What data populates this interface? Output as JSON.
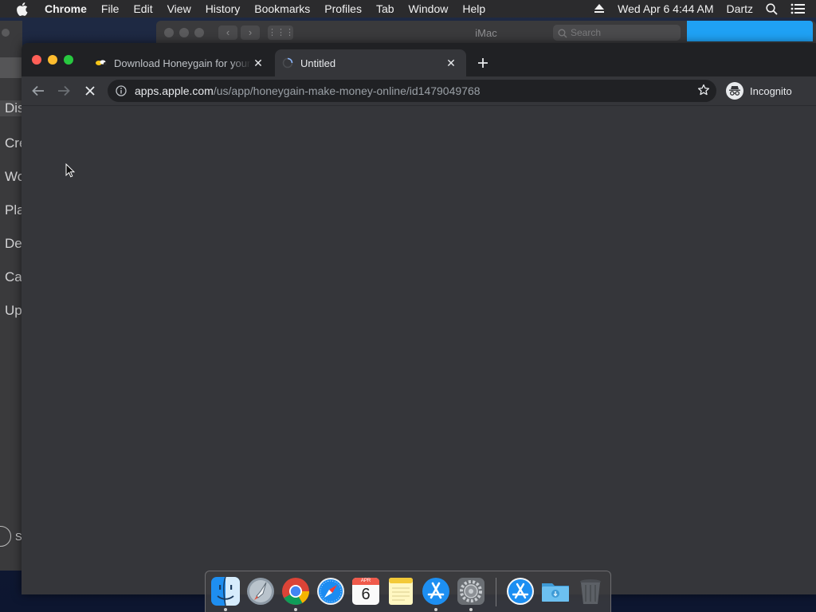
{
  "menubar": {
    "app_name": "Chrome",
    "items": [
      "File",
      "Edit",
      "View",
      "History",
      "Bookmarks",
      "Profiles",
      "Tab",
      "Window",
      "Help"
    ],
    "clock": "Wed Apr 6  4:44 AM",
    "user": "Dartz"
  },
  "background_window": {
    "title": "iMac",
    "search_placeholder": "Search"
  },
  "left_window": {
    "sidebar_items": [
      "Dis",
      "Cre",
      "Wo",
      "Pla",
      "De",
      "Ca",
      "Up"
    ],
    "bottom_label": "S"
  },
  "chrome": {
    "tabs": [
      {
        "title": "Download Honeygain for your Com",
        "active": false
      },
      {
        "title": "Untitled",
        "active": true
      }
    ],
    "omnibox": {
      "host": "apps.apple.com",
      "path": "/us/app/honeygain-make-money-online/id1479049768"
    },
    "profile_label": "Incognito",
    "page_state": "loading"
  },
  "dock": {
    "apps": [
      "finder",
      "launchpad",
      "chrome",
      "safari",
      "calendar",
      "notes",
      "app-store",
      "system-preferences",
      "app-store-downloads",
      "downloads-folder",
      "trash"
    ],
    "calendar": {
      "month": "APR",
      "day": "6"
    }
  },
  "colors": {
    "menubar": "#2b2b2d",
    "tabstrip": "#202124",
    "toolbar": "#35363a",
    "accent_blue": "#1fa1f4"
  }
}
